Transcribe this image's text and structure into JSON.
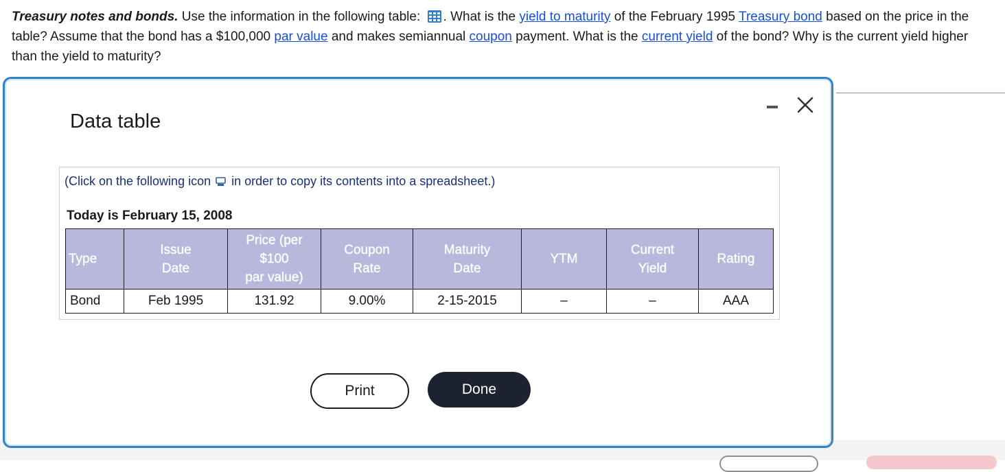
{
  "question": {
    "lead": "Treasury notes and bonds.",
    "part1": " Use the information in the following table: ",
    "part2": ". What is the ",
    "link_ytm": "yield to maturity",
    "part3": " of the February 1995 ",
    "link_tbond": "Treasury bond",
    "part4": " based on the price in the table? Assume that the bond has a $100,000 ",
    "link_par": "par value",
    "part5": " and makes semiannual ",
    "link_coupon": "coupon",
    "part6": " payment. What is the ",
    "link_cy": "current yield",
    "part7": " of the bond? Why is the current yield higher than the yield to maturity?"
  },
  "modal": {
    "title": "Data table",
    "hint_before": "(Click on the following icon",
    "hint_after": "in order to copy its contents into a spreadsheet.)",
    "today": "Today is February 15, 2008",
    "table": {
      "headers": [
        "Type",
        "Issue Date",
        "Price (per $100 par value)",
        "Coupon Rate",
        "Maturity Date",
        "YTM",
        "Current Yield",
        "Rating"
      ],
      "header_lines": {
        "issue_1": "Issue",
        "issue_2": "Date",
        "price_1": "Price (per",
        "price_2": "$100",
        "price_3": "par value)",
        "coupon_1": "Coupon",
        "coupon_2": "Rate",
        "maturity_1": "Maturity",
        "maturity_2": "Date",
        "cy_1": "Current",
        "cy_2": "Yield"
      },
      "row": {
        "type": "Bond",
        "issue_date": "Feb 1995",
        "price": "131.92",
        "coupon_rate": "9.00%",
        "maturity_date": "2-15-2015",
        "ytm": "–",
        "current_yield": "–",
        "rating": "AAA"
      }
    },
    "print_label": "Print",
    "done_label": "Done"
  },
  "icons": {
    "table_icon": "table-grid-icon",
    "copy_icon": "copy-icon",
    "minimize": "minimize-icon",
    "close": "close-icon"
  },
  "colors": {
    "link": "#1650d8",
    "modal_border": "#2e84c4",
    "table_header_bg": "#b8b8dc",
    "done_bg": "#1c2230"
  }
}
